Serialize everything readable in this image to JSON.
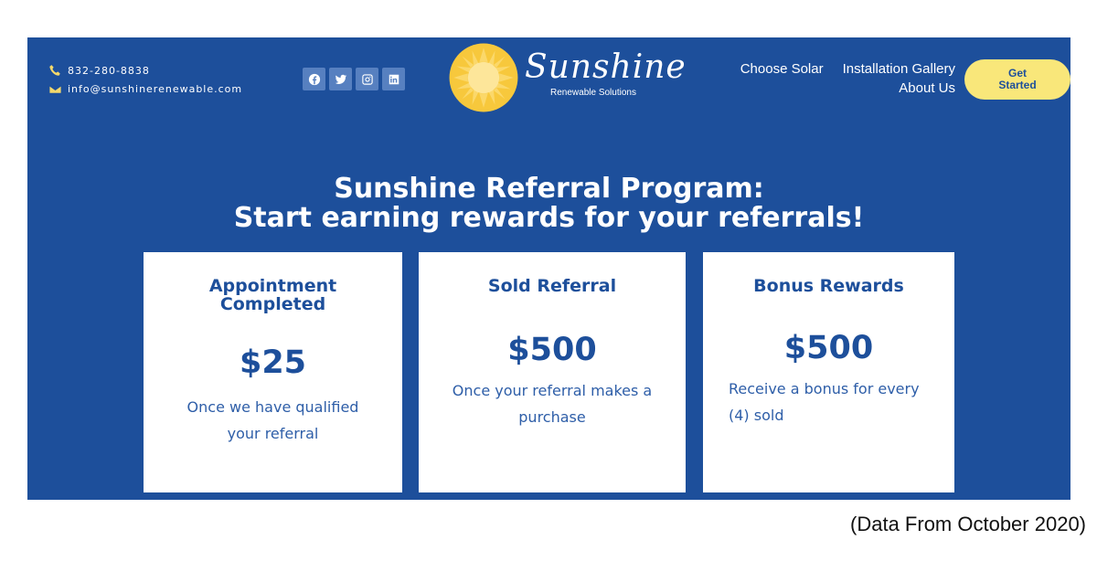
{
  "contact": {
    "phone": "832-280-8838",
    "email": "info@sunshinerenewable.com",
    "phone_icon": "phone-icon",
    "email_icon": "email-icon"
  },
  "social": [
    "facebook-icon",
    "twitter-icon",
    "instagram-icon",
    "linkedin-icon"
  ],
  "logo": {
    "brand": "Sunshine",
    "tagline": "Renewable Solutions"
  },
  "nav": {
    "choose_solar": "Choose Solar",
    "gallery": "Installation Gallery",
    "about": "About Us"
  },
  "cta": {
    "line1": "Get",
    "line2": "Started"
  },
  "hero": {
    "line1": "Sunshine Referral Program:",
    "line2": "Start earning rewards for your referrals!"
  },
  "cards": [
    {
      "title_line1": "Appointment",
      "title_line2": "Completed",
      "amount": "$25",
      "desc_line1": "Once we have qualified",
      "desc_line2": "your referral"
    },
    {
      "title": "Sold Referral",
      "amount": "$500",
      "desc_line1": "Once your referral makes a",
      "desc_line2": "purchase"
    },
    {
      "title": "Bonus Rewards",
      "amount": "$500",
      "desc_line1": "Receive a bonus for every",
      "desc_line2": "(4) sold"
    }
  ],
  "footnote": "(Data From October 2020)",
  "colors": {
    "brand_blue": "#1d4f9b",
    "accent_yellow": "#f9e77a",
    "sun_yellow": "#f7c83c"
  }
}
